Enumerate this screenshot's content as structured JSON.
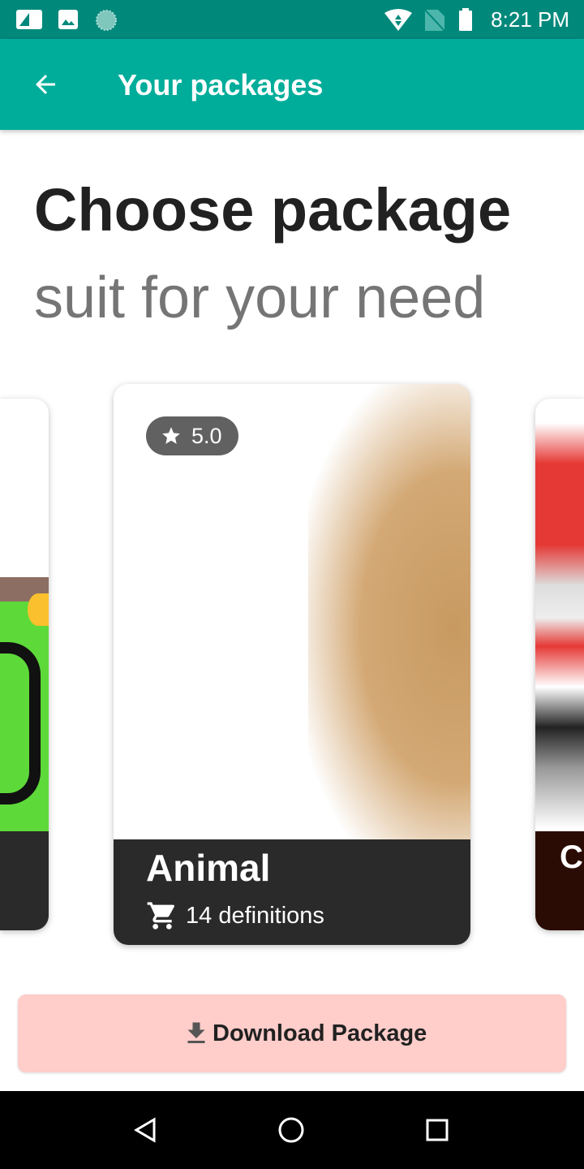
{
  "status_bar": {
    "time": "8:21 PM",
    "icons": [
      "sim-card-icon",
      "image-icon",
      "loading-icon",
      "wifi-icon",
      "no-sim-icon",
      "battery-icon"
    ]
  },
  "app_bar": {
    "title": "Your packages",
    "back_icon": "arrow-back-icon"
  },
  "heading": {
    "title": "Choose package",
    "subtitle": "suit for your need"
  },
  "packages": [
    {
      "name": "",
      "definitions": ""
    },
    {
      "name": "Animal",
      "definitions": "14 definitions",
      "rating": "5.0"
    },
    {
      "name": "C",
      "definitions": ""
    }
  ],
  "download_button": {
    "label": "Download Package",
    "icon": "download-icon"
  },
  "colors": {
    "primary": "#00ad9a",
    "primary_dark": "#00897b",
    "button_bg": "#ffcdca"
  }
}
